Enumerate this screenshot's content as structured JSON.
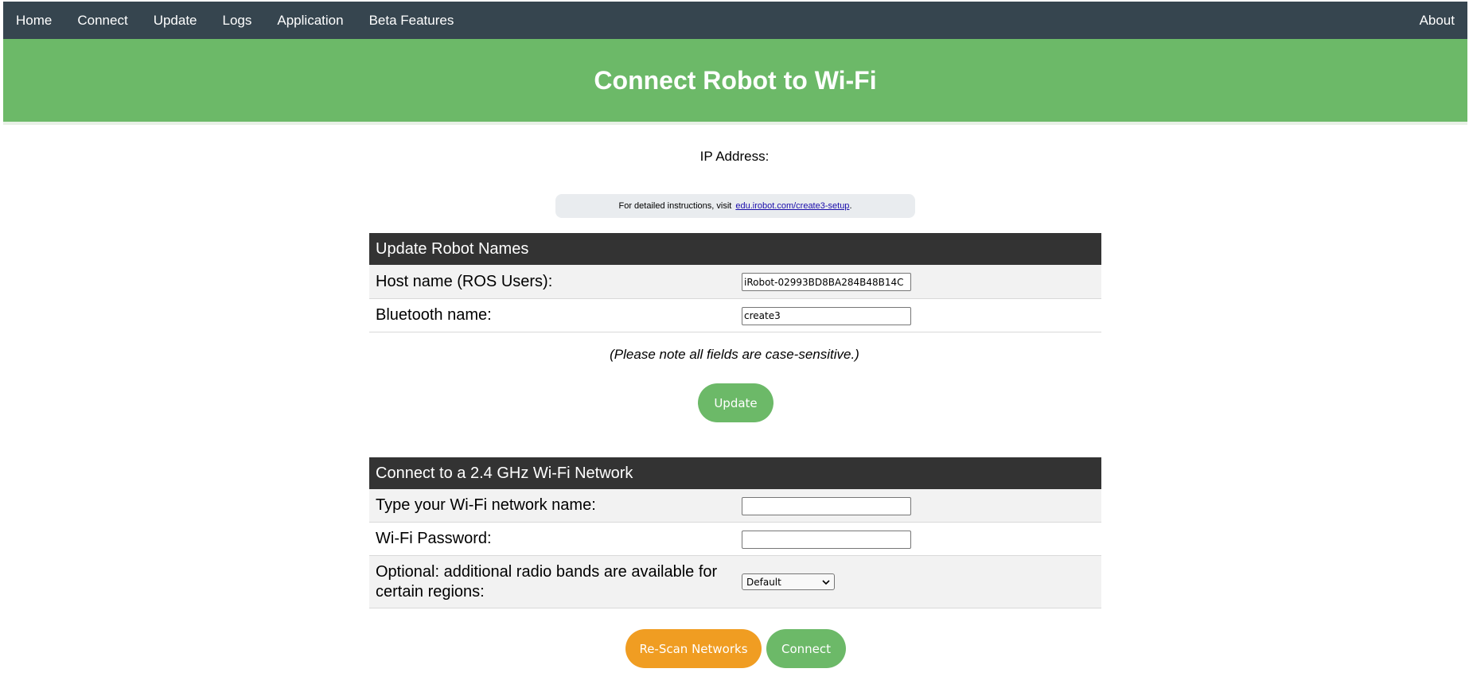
{
  "nav": {
    "left": [
      "Home",
      "Connect",
      "Update",
      "Logs",
      "Application",
      "Beta Features"
    ],
    "right": "About"
  },
  "header": {
    "title": "Connect Robot to Wi-Fi"
  },
  "ip": {
    "label": "IP Address:"
  },
  "info": {
    "text": "For detailed instructions, visit",
    "link": "edu.irobot.com/create3-setup",
    "suffix": "."
  },
  "names_panel": {
    "title": "Update Robot Names",
    "host_label": "Host name (ROS Users):",
    "host_value": "iRobot-02993BD8BA284B48B14C",
    "bt_label": "Bluetooth name:",
    "bt_value": "create3"
  },
  "note": "(Please note all fields are case-sensitive.)",
  "update_button": "Update",
  "wifi_panel": {
    "title": "Connect to a 2.4 GHz Wi-Fi Network",
    "ssid_label": "Type your Wi-Fi network name:",
    "ssid_value": "",
    "password_label": "Wi-Fi Password:",
    "password_value": "",
    "band_label": "Optional: additional radio bands are available for certain regions:",
    "band_value": "Default"
  },
  "rescan_button": "Re-Scan Networks",
  "connect_button": "Connect",
  "colors": {
    "nav_bg": "#36454f",
    "banner_bg": "#6cb968",
    "panel_header_bg": "#333333",
    "green_button": "#6cb968",
    "orange_button": "#f09d22"
  }
}
